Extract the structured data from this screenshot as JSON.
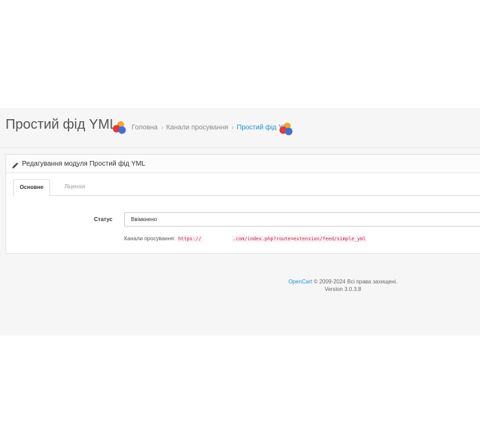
{
  "header": {
    "title": "Простий фід YML",
    "logo_icon": "opencart-colored-dots-logo",
    "breadcrumb": [
      {
        "label": "Головна",
        "active": false
      },
      {
        "label": "Канали просування",
        "active": false
      },
      {
        "label": "Простий фід YML",
        "active": true
      }
    ],
    "breadcrumb_separator": "›"
  },
  "panel": {
    "icon": "pencil-icon",
    "title": "Редагування модуля Простий фід YML",
    "tabs": [
      {
        "label": "Основне",
        "active": true
      },
      {
        "label": "Ліцензія",
        "active": false
      }
    ],
    "status": {
      "label": "Статус",
      "value": "Ввімкнено"
    },
    "feed_link": {
      "label": "Канали просування:",
      "url_start": "https://",
      "url_end": ".com/index.php?route=extension/feed/simple_yml"
    }
  },
  "footer": {
    "brand": "OpenCart",
    "copyright": "© 2009-2024 Всі права захищені.",
    "version": "Version 3.0.3.8"
  },
  "colors": {
    "link": "#1e91cf",
    "code": "#c7254e",
    "background": "#f6f6f6"
  }
}
